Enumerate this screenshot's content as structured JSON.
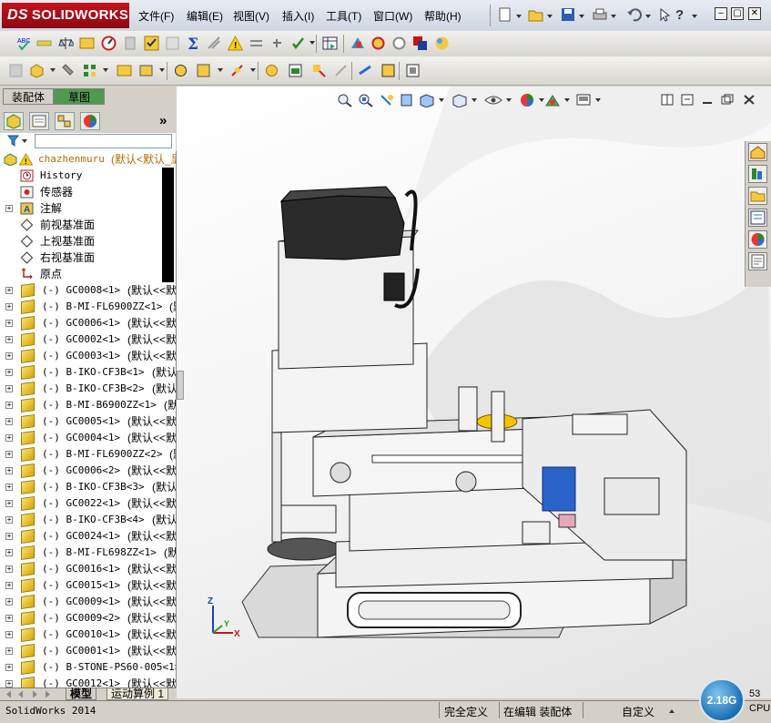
{
  "app": {
    "brand": "SOLIDWORKS",
    "brand_prefix": "DS"
  },
  "menu": [
    "文件(F)",
    "编辑(E)",
    "视图(V)",
    "插入(I)",
    "工具(T)",
    "窗口(W)",
    "帮助(H)"
  ],
  "quick_help_label": "?",
  "left_panel": {
    "tabs": [
      "装配体",
      "草图"
    ],
    "manager_icons": [
      "feature-manager-icon",
      "property-manager-icon",
      "configuration-manager-icon",
      "display-manager-icon"
    ],
    "expand_glyph": "»",
    "root": {
      "name": "chazhenmuru",
      "config": "(默认<默认_显"
    },
    "features": [
      {
        "label": "History",
        "icon": "history-icon"
      },
      {
        "label": "传感器",
        "icon": "sensor-icon"
      },
      {
        "label": "注解",
        "icon": "annotation-icon"
      },
      {
        "label": "前视基准面",
        "icon": "plane-icon"
      },
      {
        "label": "上视基准面",
        "icon": "plane-icon"
      },
      {
        "label": "右视基准面",
        "icon": "plane-icon"
      },
      {
        "label": "原点",
        "icon": "origin-icon"
      }
    ],
    "components": [
      {
        "name": "(-) GC0008<1>",
        "cfg": "(默认<<默认"
      },
      {
        "name": "(-) B-MI-FL6900ZZ<1>",
        "cfg": "(默认"
      },
      {
        "name": "(-) GC0006<1>",
        "cfg": "(默认<<默认"
      },
      {
        "name": "(-) GC0002<1>",
        "cfg": "(默认<<默认"
      },
      {
        "name": "(-) GC0003<1>",
        "cfg": "(默认<<默认"
      },
      {
        "name": "(-) B-IKO-CF3B<1>",
        "cfg": "(默认<<默"
      },
      {
        "name": "(-) B-IKO-CF3B<2>",
        "cfg": "(默认<<默"
      },
      {
        "name": "(-) B-MI-B6900ZZ<1>",
        "cfg": "(默认"
      },
      {
        "name": "(-) GC0005<1>",
        "cfg": "(默认<<默认"
      },
      {
        "name": "(-) GC0004<1>",
        "cfg": "(默认<<默认"
      },
      {
        "name": "(-) B-MI-FL6900ZZ<2>",
        "cfg": "(默认"
      },
      {
        "name": "(-) GC0006<2>",
        "cfg": "(默认<<默认"
      },
      {
        "name": "(-) B-IKO-CF3B<3>",
        "cfg": "(默认<<默"
      },
      {
        "name": "(-) GC0022<1>",
        "cfg": "(默认<<默认"
      },
      {
        "name": "(-) B-IKO-CF3B<4>",
        "cfg": "(默认<<默"
      },
      {
        "name": "(-) GC0024<1>",
        "cfg": "(默认<<默认"
      },
      {
        "name": "(-) B-MI-FL698ZZ<1>",
        "cfg": "(默认"
      },
      {
        "name": "(-) GC0016<1>",
        "cfg": "(默认<<默认"
      },
      {
        "name": "(-) GC0015<1>",
        "cfg": "(默认<<默认"
      },
      {
        "name": "(-) GC0009<1>",
        "cfg": "(默认<<默认"
      },
      {
        "name": "(-) GC0009<2>",
        "cfg": "(默认<<默认"
      },
      {
        "name": "(-) GC0010<1>",
        "cfg": "(默认<<默认"
      },
      {
        "name": "(-) GC0001<1>",
        "cfg": "(默认<<默认"
      },
      {
        "name": "(-) B-STONE-PS60-005<1>",
        "cfg": ""
      },
      {
        "name": "(-) GC0012<1>",
        "cfg": "(默认<<默认"
      }
    ],
    "bottom_tabs": [
      "模型",
      "运动算例 1"
    ]
  },
  "graphics": {
    "triad": {
      "x_label": "X",
      "y_label": "Y",
      "z_label": "Z"
    },
    "heads_up_icons": [
      "zoom-to-fit-icon",
      "zoom-area-icon",
      "previous-view-icon",
      "section-view-icon",
      "view-orientation-icon",
      "display-style-icon",
      "hide-show-icon",
      "edit-appearance-icon",
      "apply-scene-icon",
      "view-settings-icon"
    ]
  },
  "task_pane_icons": [
    "home-icon",
    "design-library-icon",
    "file-explorer-icon",
    "view-palette-icon",
    "appearances-icon",
    "custom-properties-icon"
  ],
  "status": {
    "app_version": "SolidWorks 2014",
    "definition": "完全定义",
    "mode": "在编辑 装配体",
    "units": "自定义",
    "performance": "2.18G",
    "cpu_label": "CPU",
    "cpu_value": "53"
  }
}
